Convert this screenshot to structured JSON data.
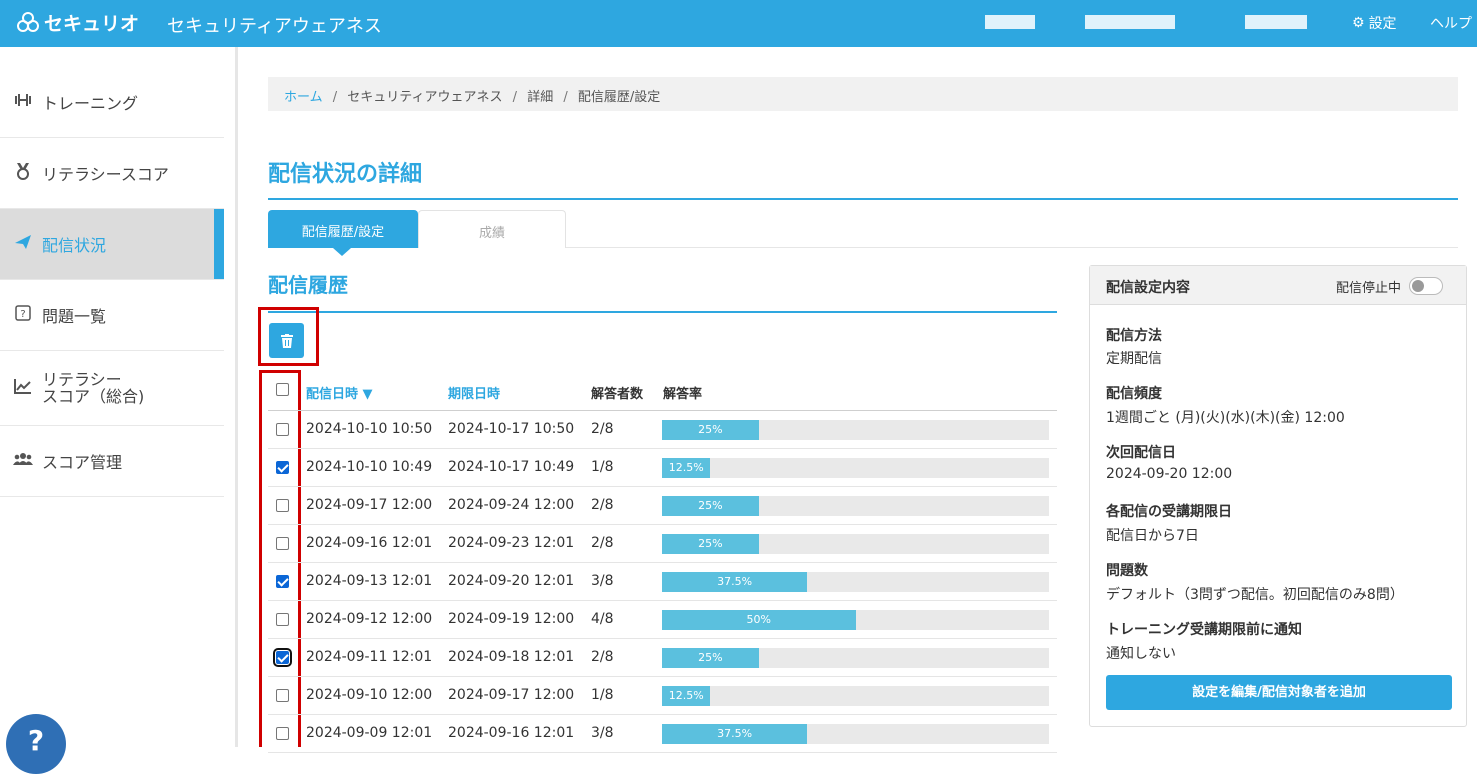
{
  "header": {
    "logo_text": "セキュリオ",
    "app_title": "セキュリティアウェアネス",
    "settings_label": "設定",
    "help_label": "ヘルプ"
  },
  "sidebar": {
    "items": [
      {
        "label": "トレーニング",
        "icon": "dumbbell-icon"
      },
      {
        "label": "リテラシースコア",
        "icon": "medal-icon"
      },
      {
        "label": "配信状況",
        "icon": "paper-plane-icon"
      },
      {
        "label": "問題一覧",
        "icon": "question-box-icon"
      },
      {
        "label_line1": "リテラシー",
        "label_line2": "スコア（総合)",
        "icon": "line-chart-icon"
      },
      {
        "label": "スコア管理",
        "icon": "users-icon"
      }
    ],
    "help_glyph": "?"
  },
  "breadcrumb": {
    "home": "ホーム",
    "item2": "セキュリティアウェアネス",
    "item3": "詳細",
    "current": "配信履歴/設定",
    "sep": "/"
  },
  "page_title": "配信状況の詳細",
  "tabs": [
    {
      "label": "配信履歴/設定",
      "active": true
    },
    {
      "label": "成績",
      "active": false
    }
  ],
  "history": {
    "title": "配信履歴",
    "columns": {
      "sent_at": "配信日時 ▼",
      "deadline": "期限日時",
      "respondents": "解答者数",
      "rate": "解答率"
    },
    "rows": [
      {
        "sent_at": "2024-10-10 10:50",
        "deadline": "2024-10-17 10:50",
        "respondents": "2/8",
        "rate_label": "25%",
        "rate": 25,
        "checked": false
      },
      {
        "sent_at": "2024-10-10 10:49",
        "deadline": "2024-10-17 10:49",
        "respondents": "1/8",
        "rate_label": "12.5%",
        "rate": 12.5,
        "checked": true
      },
      {
        "sent_at": "2024-09-17 12:00",
        "deadline": "2024-09-24 12:00",
        "respondents": "2/8",
        "rate_label": "25%",
        "rate": 25,
        "checked": false
      },
      {
        "sent_at": "2024-09-16 12:01",
        "deadline": "2024-09-23 12:01",
        "respondents": "2/8",
        "rate_label": "25%",
        "rate": 25,
        "checked": false
      },
      {
        "sent_at": "2024-09-13 12:01",
        "deadline": "2024-09-20 12:01",
        "respondents": "3/8",
        "rate_label": "37.5%",
        "rate": 37.5,
        "checked": true
      },
      {
        "sent_at": "2024-09-12 12:00",
        "deadline": "2024-09-19 12:00",
        "respondents": "4/8",
        "rate_label": "50%",
        "rate": 50,
        "checked": false
      },
      {
        "sent_at": "2024-09-11 12:01",
        "deadline": "2024-09-18 12:01",
        "respondents": "2/8",
        "rate_label": "25%",
        "rate": 25,
        "checked": true
      },
      {
        "sent_at": "2024-09-10 12:00",
        "deadline": "2024-09-17 12:00",
        "respondents": "1/8",
        "rate_label": "12.5%",
        "rate": 12.5,
        "checked": false
      },
      {
        "sent_at": "2024-09-09 12:01",
        "deadline": "2024-09-16 12:01",
        "respondents": "3/8",
        "rate_label": "37.5%",
        "rate": 37.5,
        "checked": false
      }
    ]
  },
  "settings": {
    "title": "配信設定内容",
    "stop_label": "配信停止中",
    "method_label": "配信方法",
    "method_value": "定期配信",
    "frequency_label": "配信頻度",
    "frequency_value": "1週間ごと (月)(火)(水)(木)(金) 12:00",
    "next_label": "次回配信日",
    "next_value": "2024-09-20 12:00",
    "deadline_label": "各配信の受講期限日",
    "deadline_value": "配信日から7日",
    "count_label": "問題数",
    "count_value": "デフォルト（3問ずつ配信。初回配信のみ8問）",
    "notify_label": "トレーニング受講期限前に通知",
    "notify_value": "通知しない",
    "edit_button": "設定を編集/配信対象者を追加"
  },
  "colors": {
    "brand": "#2ea7e0",
    "bar": "#5bc0de",
    "highlight": "#d00000"
  }
}
